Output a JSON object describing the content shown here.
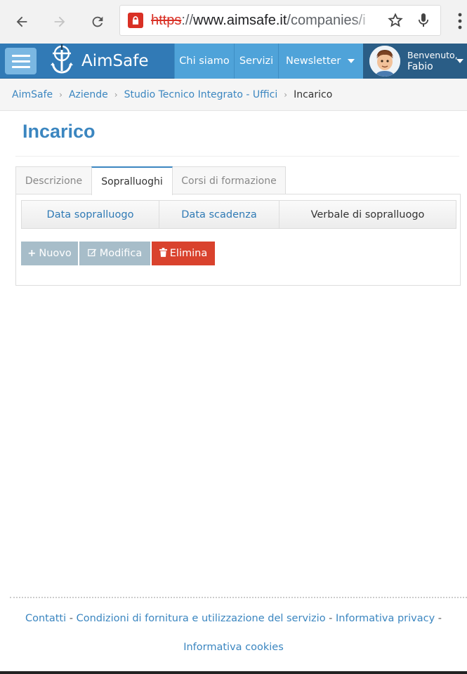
{
  "browser": {
    "url_scheme": "https",
    "url_sep": "://",
    "url_host": "www.aimsafe.it",
    "url_path": "/companies/i"
  },
  "navbar": {
    "brand": "AimSafe",
    "items": [
      "Chi siamo",
      "Servizi",
      "Newsletter"
    ],
    "greeting": "Benvenuto,",
    "user_name": "Fabio"
  },
  "breadcrumb": {
    "items": [
      "AimSafe",
      "Aziende",
      "Studio Tecnico Integrato - Uffici"
    ],
    "current": "Incarico"
  },
  "page": {
    "title": "Incarico",
    "tabs": [
      "Descrizione",
      "Sopralluoghi",
      "Corsi di formazione"
    ],
    "active_tab": "Sopralluoghi",
    "columns": [
      "Data sopralluogo",
      "Data scadenza",
      "Verbale di sopralluogo"
    ],
    "buttons": {
      "new": "Nuovo",
      "edit": "Modifica",
      "delete": "Elimina"
    }
  },
  "footer": {
    "links": [
      "Contatti",
      "Condizioni di fornitura e utilizzazione del servizio",
      "Informativa privacy",
      "Informativa cookies"
    ],
    "separator": "-"
  },
  "colors": {
    "navbar": "#317ab6",
    "nav_item": "#4fa3d9",
    "link": "#3b86c0",
    "delete": "#d9422d",
    "gray_button": "#a7bdc9"
  }
}
